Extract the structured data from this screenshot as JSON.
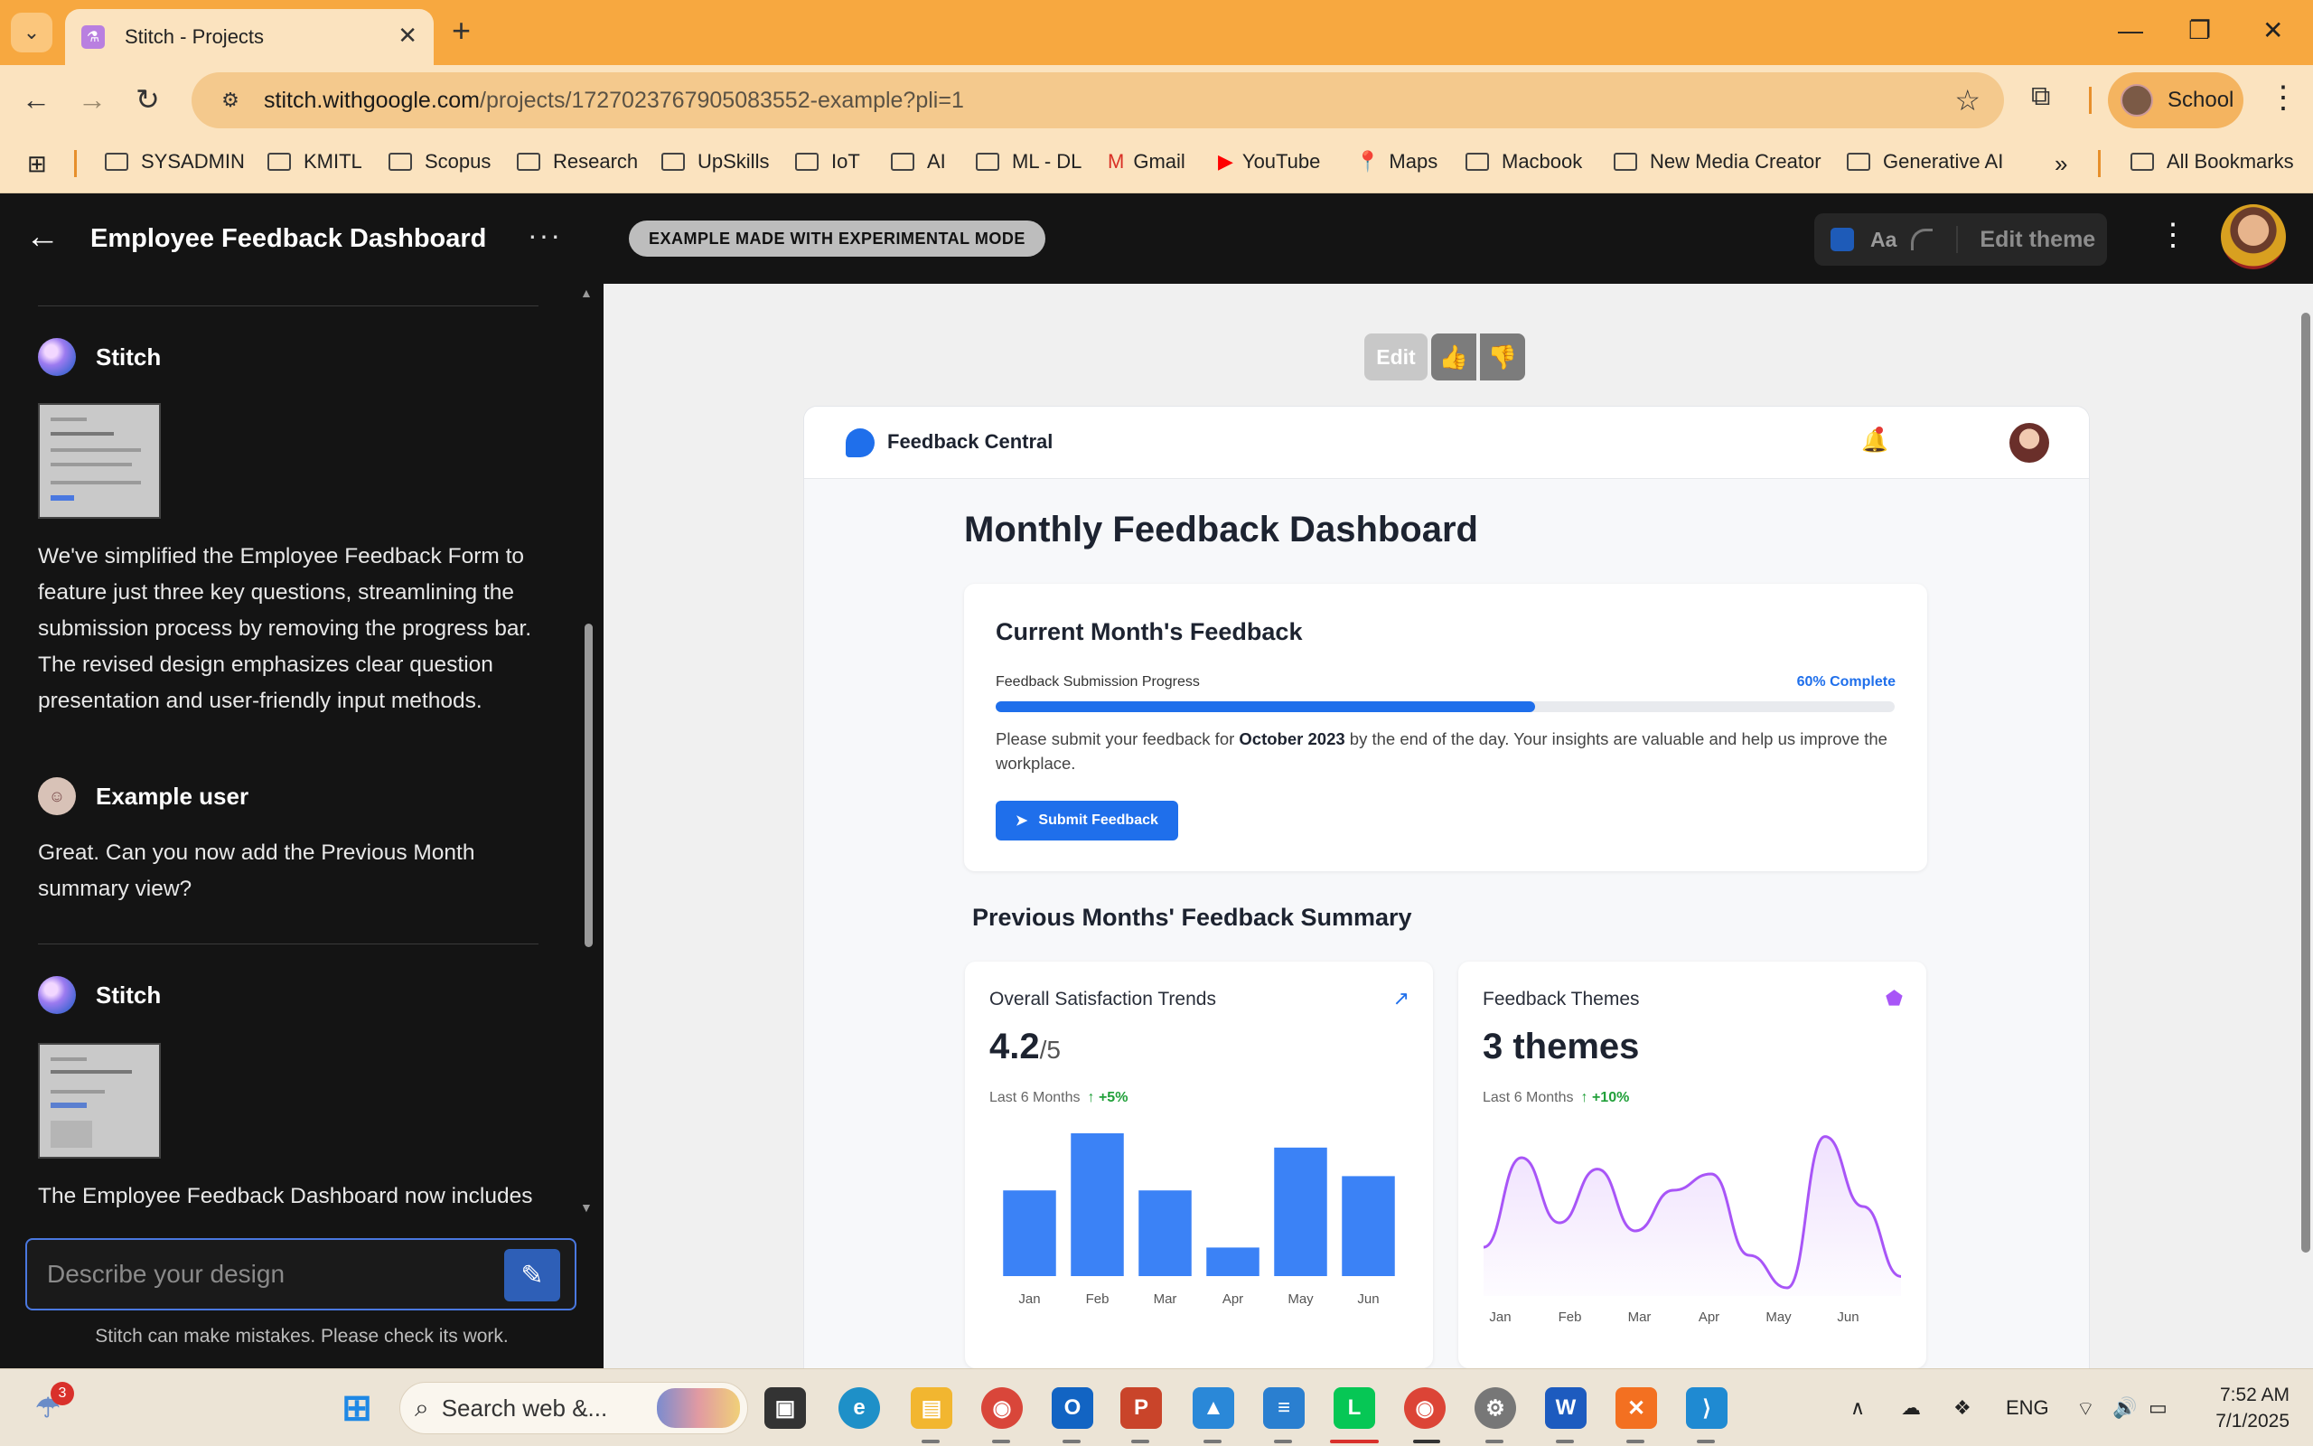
{
  "browser": {
    "tab_title": "Stitch - Projects",
    "url_host": "stitch.withgoogle.com",
    "url_path": "/projects/1727023767905083552-example?pli=1",
    "profile_name": "School",
    "bookmarks": [
      "SYSADMIN",
      "KMITL",
      "Scopus",
      "Research",
      "UpSkills",
      "IoT",
      "AI",
      "ML - DL",
      "Gmail",
      "YouTube",
      "Maps",
      "Macbook",
      "New Media Creator",
      "Generative AI"
    ],
    "all_bookmarks": "All Bookmarks"
  },
  "app": {
    "project_title": "Employee Feedback Dashboard",
    "mode_pill": "EXAMPLE MADE WITH EXPERIMENTAL MODE",
    "theme_aa": "Aa",
    "edit_theme": "Edit theme",
    "accent": "#1f6feb"
  },
  "chat": {
    "msg1_author": "Stitch",
    "msg1_text": "We've simplified the Employee Feedback Form to feature just three key questions, streamlining the submission process by removing the progress bar. The revised design emphasizes clear question presentation and user-friendly input methods.",
    "msg2_author": "Example user",
    "msg2_text": "Great. Can you now add the Previous Month summary view?",
    "msg3_author": "Stitch",
    "msg3_text": "The Employee Feedback Dashboard now includes",
    "input_placeholder": "Describe your design",
    "disclaimer": "Stitch can make mistakes. Please check its work."
  },
  "canvas": {
    "edit_label": "Edit"
  },
  "mock": {
    "brand": "Feedback Central",
    "page_title": "Monthly Feedback Dashboard",
    "current_card": {
      "title": "Current Month's Feedback",
      "progress_label": "Feedback Submission Progress",
      "progress_text": "60% Complete",
      "progress_value": 0.6,
      "body_before": "Please submit your feedback for ",
      "body_bold": "October 2023",
      "body_after": " by the end of the day. Your insights are valuable and help us improve the workplace.",
      "button": "Submit Feedback"
    },
    "prev_title": "Previous Months' Feedback Summary",
    "satisfaction": {
      "title": "Overall Satisfaction Trends",
      "value": "4.2",
      "denominator": "/5",
      "period": "Last 6 Months",
      "change": "+5%"
    },
    "themes": {
      "title": "Feedback Themes",
      "value": "3 themes",
      "period": "Last 6 Months",
      "change": "+10%"
    }
  },
  "chart_data": [
    {
      "type": "bar",
      "categories": [
        "Jan",
        "Feb",
        "Mar",
        "Apr",
        "May",
        "Jun"
      ],
      "values": [
        60,
        100,
        60,
        20,
        90,
        70
      ],
      "color": "#3b82f6",
      "ylim": [
        0,
        100
      ],
      "grid": false
    },
    {
      "type": "area",
      "categories": [
        "Jan",
        "Feb",
        "Mar",
        "Apr",
        "May",
        "Jun"
      ],
      "x": [
        0,
        0.5,
        1,
        1.5,
        2,
        2.5,
        3,
        3.5,
        4,
        4.5,
        5,
        5.5
      ],
      "values": [
        30,
        85,
        45,
        78,
        40,
        65,
        75,
        25,
        5,
        98,
        55,
        12
      ],
      "color": "#a855f7",
      "ylim": [
        0,
        100
      ],
      "grid": false
    }
  ],
  "taskbar": {
    "search_placeholder": "Search web &...",
    "notification_count": "3",
    "lang": "ENG",
    "time": "7:52 AM",
    "date": "7/1/2025"
  }
}
